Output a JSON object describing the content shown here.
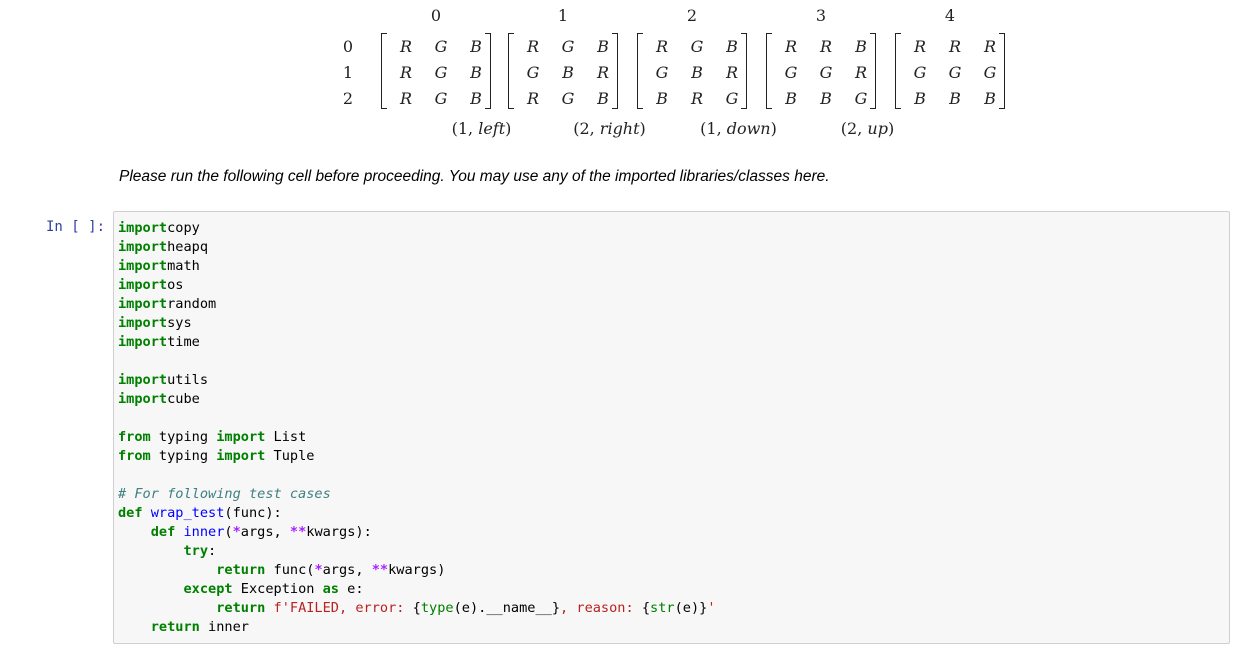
{
  "figure": {
    "column_indices": [
      "0",
      "1",
      "2",
      "3",
      "4"
    ],
    "row_indices": [
      "0",
      "1",
      "2"
    ],
    "matrices": [
      [
        [
          "R",
          "G",
          "B"
        ],
        [
          "R",
          "G",
          "B"
        ],
        [
          "R",
          "G",
          "B"
        ]
      ],
      [
        [
          "R",
          "G",
          "B"
        ],
        [
          "G",
          "B",
          "R"
        ],
        [
          "R",
          "G",
          "B"
        ]
      ],
      [
        [
          "R",
          "G",
          "B"
        ],
        [
          "G",
          "B",
          "R"
        ],
        [
          "B",
          "R",
          "G"
        ]
      ],
      [
        [
          "R",
          "R",
          "B"
        ],
        [
          "G",
          "G",
          "R"
        ],
        [
          "B",
          "B",
          "G"
        ]
      ],
      [
        [
          "R",
          "R",
          "R"
        ],
        [
          "G",
          "G",
          "G"
        ],
        [
          "B",
          "B",
          "B"
        ]
      ]
    ],
    "moves": [
      {
        "num": "1",
        "dir": "left"
      },
      {
        "num": "2",
        "dir": "right"
      },
      {
        "num": "1",
        "dir": "down"
      },
      {
        "num": "2",
        "dir": "up"
      }
    ]
  },
  "note": "Please run the following cell before proceeding. You may use any of the imported libraries/classes here.",
  "cell": {
    "prompt": "In [ ]:",
    "lines": [
      [
        [
          "kw",
          "import"
        ],
        [
          "",
          "copy"
        ]
      ],
      [
        [
          "kw",
          "import"
        ],
        [
          "",
          "heapq"
        ]
      ],
      [
        [
          "kw",
          "import"
        ],
        [
          "",
          "math"
        ]
      ],
      [
        [
          "kw",
          "import"
        ],
        [
          "",
          "os"
        ]
      ],
      [
        [
          "kw",
          "import"
        ],
        [
          "",
          "random"
        ]
      ],
      [
        [
          "kw",
          "import"
        ],
        [
          "",
          "sys"
        ]
      ],
      [
        [
          "kw",
          "import"
        ],
        [
          "",
          "time"
        ]
      ],
      [],
      [
        [
          "kw",
          "import"
        ],
        [
          "",
          "utils"
        ]
      ],
      [
        [
          "kw",
          "import"
        ],
        [
          "",
          "cube"
        ]
      ],
      [],
      [
        [
          "kw",
          "from"
        ],
        [
          "",
          " typing "
        ],
        [
          "kw",
          "import"
        ],
        [
          "",
          " List"
        ]
      ],
      [
        [
          "kw",
          "from"
        ],
        [
          "",
          " typing "
        ],
        [
          "kw",
          "import"
        ],
        [
          "",
          " Tuple"
        ]
      ],
      [],
      [
        [
          "cm",
          "# For following test cases"
        ]
      ],
      [
        [
          "kw",
          "def"
        ],
        [
          "",
          " "
        ],
        [
          "fn",
          "wrap_test"
        ],
        [
          "",
          "(func):"
        ]
      ],
      [
        [
          "",
          "    "
        ],
        [
          "kw",
          "def"
        ],
        [
          "",
          " "
        ],
        [
          "fn",
          "inner"
        ],
        [
          "",
          "("
        ],
        [
          "op",
          "*"
        ],
        [
          "",
          "args, "
        ],
        [
          "op",
          "**"
        ],
        [
          "",
          "kwargs):"
        ]
      ],
      [
        [
          "",
          "        "
        ],
        [
          "kw",
          "try"
        ],
        [
          "",
          ":"
        ]
      ],
      [
        [
          "",
          "            "
        ],
        [
          "kw",
          "return"
        ],
        [
          "",
          " func("
        ],
        [
          "op",
          "*"
        ],
        [
          "",
          "args, "
        ],
        [
          "op",
          "**"
        ],
        [
          "",
          "kwargs)"
        ]
      ],
      [
        [
          "",
          "        "
        ],
        [
          "kw",
          "except"
        ],
        [
          "",
          " Exception "
        ],
        [
          "kw",
          "as"
        ],
        [
          "",
          " e:"
        ]
      ],
      [
        [
          "",
          "            "
        ],
        [
          "kw",
          "return"
        ],
        [
          "",
          " "
        ],
        [
          "str",
          "f'FAILED, error: "
        ],
        [
          "",
          "{"
        ],
        [
          "bi",
          "type"
        ],
        [
          "",
          "(e)."
        ],
        [
          "",
          "__name__"
        ],
        [
          "",
          "}"
        ],
        [
          "str",
          ", reason: "
        ],
        [
          "",
          "{"
        ],
        [
          "bi",
          "str"
        ],
        [
          "",
          "(e)}"
        ],
        [
          "str",
          "'"
        ]
      ],
      [
        [
          "",
          "    "
        ],
        [
          "kw",
          "return"
        ],
        [
          "",
          " inner"
        ]
      ]
    ]
  }
}
